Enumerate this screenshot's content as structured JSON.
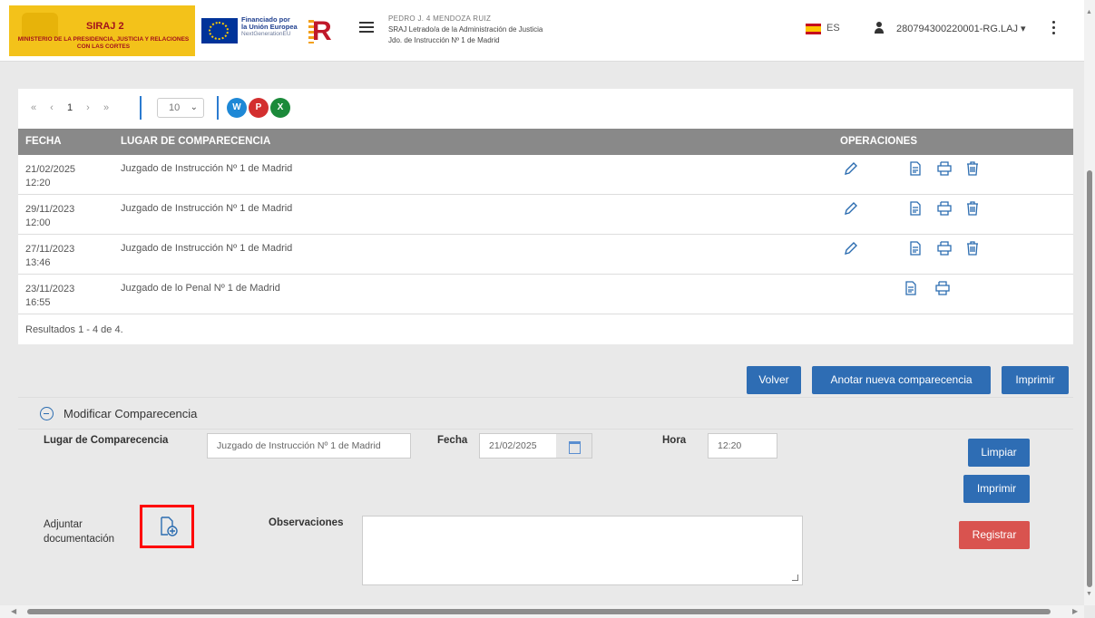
{
  "header": {
    "app_name": "SIRAJ 2",
    "ministry": "MINISTERIO DE LA PRESIDENCIA, JUSTICIA Y RELACIONES CON LAS CORTES",
    "eu_line1": "Financiado por",
    "eu_line2": "la Unión Europea",
    "eu_line3": "NextGenerationEU",
    "user_name": "PEDRO J. 4 MENDOZA RUIZ",
    "user_role": "SRAJ Letrado/a de la Administración de Justicia",
    "user_court": "Jdo. de Instrucción Nº 1 de Madrid",
    "language": "ES",
    "user_code": "280794300220001-RG.LAJ"
  },
  "pagination": {
    "first": "«",
    "prev": "‹",
    "page": "1",
    "next": "›",
    "last": "»",
    "page_size": "10",
    "page_size_chevron": "⌄"
  },
  "exports": [
    {
      "label": "W",
      "color": "#1e88d6"
    },
    {
      "label": "P",
      "color": "#d32f2f"
    },
    {
      "label": "X",
      "color": "#1b8a3a"
    }
  ],
  "table": {
    "headers": {
      "fecha": "FECHA",
      "lugar": "LUGAR DE COMPARECENCIA",
      "operaciones": "OPERACIONES"
    },
    "rows": [
      {
        "date": "21/02/2025",
        "time": "12:20",
        "lugar": "Juzgado de Instrucción Nº 1 de Madrid"
      },
      {
        "date": "29/11/2023",
        "time": "12:00",
        "lugar": "Juzgado de Instrucción Nº 1 de Madrid"
      },
      {
        "date": "27/11/2023",
        "time": "13:46",
        "lugar": "Juzgado de Instrucción Nº 1 de Madrid"
      },
      {
        "date": "23/11/2023",
        "time": "16:55",
        "lugar": "Juzgado de lo Penal Nº 1 de Madrid"
      }
    ]
  },
  "results_count": "Resultados 1 - 4 de 4.",
  "actions": {
    "volver": "Volver",
    "anotar": "Anotar nueva comparecencia",
    "imprimir": "Imprimir"
  },
  "form": {
    "title": "Modificar Comparecencia",
    "lugar_label": "Lugar de Comparecencia",
    "lugar_value": "Juzgado de Instrucción Nº 1 de Madrid",
    "fecha_label": "Fecha",
    "fecha_value": "21/02/2025",
    "hora_label": "Hora",
    "hora_value": "12:20",
    "adjuntar_label_1": "Adjuntar",
    "adjuntar_label_2": "documentación",
    "observaciones_label": "Observaciones",
    "limpiar": "Limpiar",
    "imprimir": "Imprimir",
    "registrar": "Registrar"
  }
}
